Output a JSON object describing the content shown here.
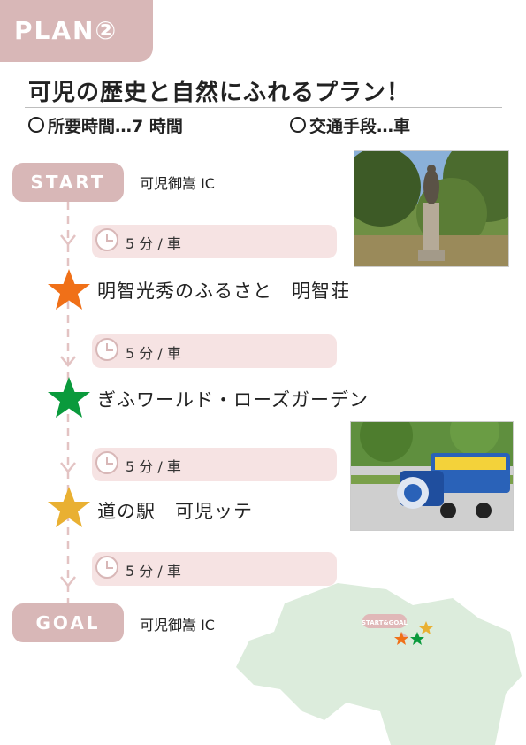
{
  "plan_badge": "PLAN②",
  "title": "可児の歴史と自然にふれるプラン！",
  "meta": {
    "duration": "所要時間…7 時間",
    "transport": "交通手段…車"
  },
  "start": {
    "badge": "START",
    "label": "可児御嵩 IC"
  },
  "goal": {
    "badge": "GOAL",
    "label": "可児御嵩 IC"
  },
  "travel_segments": [
    "5 分 / 車",
    "5 分 / 車",
    "5 分 / 車",
    "5 分 / 車"
  ],
  "stops": [
    {
      "name": "明智光秀のふるさと　明智荘",
      "star_color": "#f07018"
    },
    {
      "name": "ぎふワールド・ローズガーデン",
      "star_color": "#0a9a3c"
    },
    {
      "name": "道の駅　可児ッテ",
      "star_color": "#e9b032"
    }
  ],
  "map": {
    "route_label": "START&GOAL",
    "land_color": "#dcecdc"
  },
  "colors": {
    "badge": "#d8b7b7",
    "pill_bg": "#f6e3e3",
    "dash": "#e3c3c3"
  }
}
